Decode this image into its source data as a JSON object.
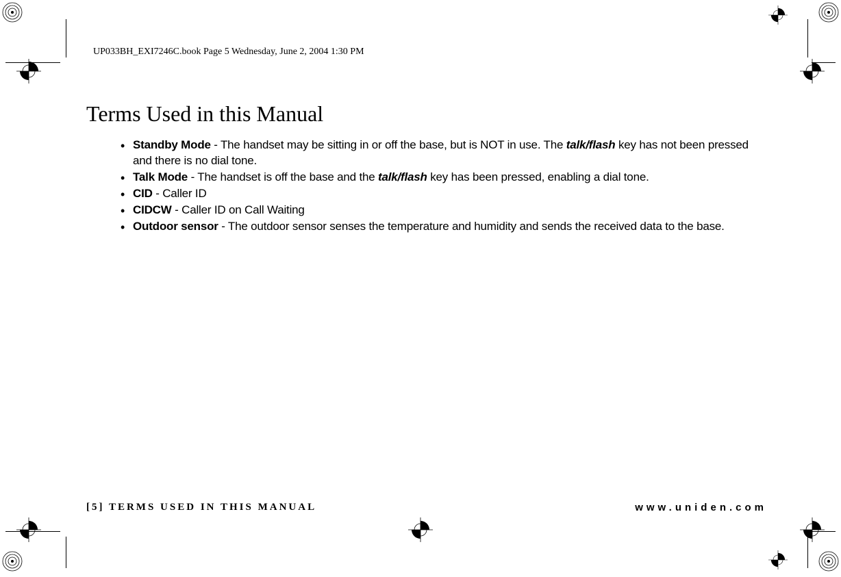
{
  "header": "UP033BH_EXI7246C.book  Page 5  Wednesday, June 2, 2004  1:30 PM",
  "title": "Terms Used in this Manual",
  "terms": [
    {
      "name": "Standby Mode",
      "text_before_key": " - The handset may be sitting in or off the base, but is NOT in use. The ",
      "key": "talk/flash",
      "text_after_key": " key has not been pressed and there is no dial tone."
    },
    {
      "name": "Talk Mode",
      "text_before_key": " - The handset is off the base and the ",
      "key": "talk/flash",
      "text_after_key": " key has been pressed, enabling a dial tone."
    },
    {
      "name": "CID",
      "text_before_key": " - Caller ID",
      "key": "",
      "text_after_key": ""
    },
    {
      "name": "CIDCW",
      "text_before_key": " - Caller ID on Call Waiting",
      "key": "",
      "text_after_key": ""
    },
    {
      "name": "Outdoor sensor",
      "text_before_key": " - The outdoor sensor senses the temperature and humidity and sends the received data to the base.",
      "key": "",
      "text_after_key": ""
    }
  ],
  "footer": {
    "left": "[5] TERMS USED IN THIS MANUAL",
    "right": "www.uniden.com"
  }
}
